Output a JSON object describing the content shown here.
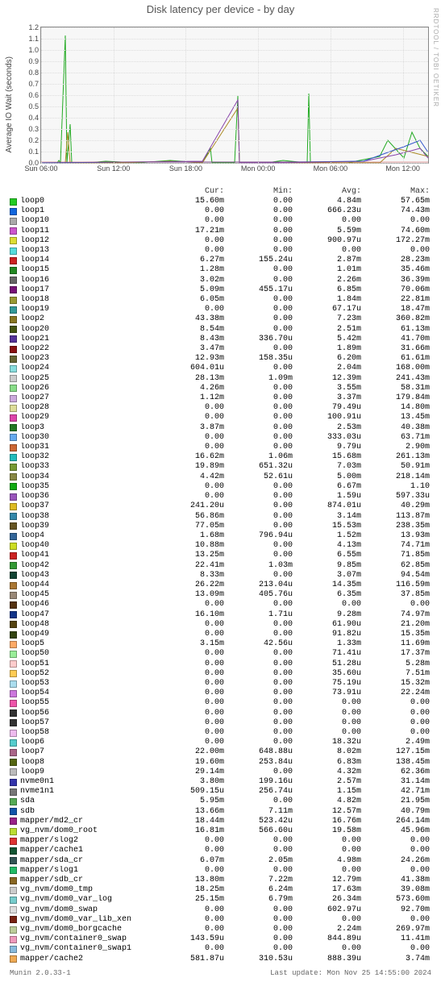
{
  "title": "Disk latency per device - by day",
  "ylabel": "Average IO Wait (seconds)",
  "side_credit": "RRDTOOL / TOBI OETIKER",
  "footer_left": "Munin 2.0.33-1",
  "footer_right": "Last update: Mon Nov 25 14:55:00 2024",
  "header": {
    "cur": "Cur:",
    "min": "Min:",
    "avg": "Avg:",
    "max": "Max:"
  },
  "chart_data": {
    "type": "line",
    "xlabel": "",
    "ylabel": "Average IO Wait (seconds)",
    "ylim": [
      0,
      1.2
    ],
    "yticks": [
      0.0,
      0.1,
      0.2,
      0.3,
      0.4,
      0.5,
      0.6,
      0.7,
      0.8,
      0.9,
      1.0,
      1.1,
      1.2
    ],
    "xticks": [
      "Sun 06:00",
      "Sun 12:00",
      "Sun 18:00",
      "Mon 00:00",
      "Mon 06:00",
      "Mon 12:00"
    ],
    "note": "Dense multi-series time-series; per-series summary stats given below (Cur/Min/Avg/Max). Values suffixed 'm' are milli (×1e-3), 'u' are micro (×1e-6).",
    "series": [
      {
        "name": "loop0",
        "color": "#22cc22",
        "cur": "15.60m",
        "min": "0.00",
        "avg": "4.84m",
        "max": "57.65m"
      },
      {
        "name": "loop1",
        "color": "#1166dd",
        "cur": "0.00",
        "min": "0.00",
        "avg": "666.23u",
        "max": "74.43m"
      },
      {
        "name": "loop10",
        "color": "#aaaaaa",
        "cur": "0.00",
        "min": "0.00",
        "avg": "0.00",
        "max": "0.00"
      },
      {
        "name": "loop11",
        "color": "#cc55cc",
        "cur": "17.21m",
        "min": "0.00",
        "avg": "5.59m",
        "max": "74.60m"
      },
      {
        "name": "loop12",
        "color": "#dddd33",
        "cur": "0.00",
        "min": "0.00",
        "avg": "900.97u",
        "max": "172.27m"
      },
      {
        "name": "loop13",
        "color": "#55dddd",
        "cur": "0.00",
        "min": "0.00",
        "avg": "0.00",
        "max": "0.00"
      },
      {
        "name": "loop14",
        "color": "#cc2222",
        "cur": "6.27m",
        "min": "155.24u",
        "avg": "2.87m",
        "max": "28.23m"
      },
      {
        "name": "loop15",
        "color": "#228822",
        "cur": "1.28m",
        "min": "0.00",
        "avg": "1.01m",
        "max": "35.46m"
      },
      {
        "name": "loop16",
        "color": "#666666",
        "cur": "3.02m",
        "min": "0.00",
        "avg": "2.26m",
        "max": "36.39m"
      },
      {
        "name": "loop17",
        "color": "#771177",
        "cur": "5.09m",
        "min": "455.17u",
        "avg": "6.85m",
        "max": "70.06m"
      },
      {
        "name": "loop18",
        "color": "#999933",
        "cur": "6.05m",
        "min": "0.00",
        "avg": "1.84m",
        "max": "22.81m"
      },
      {
        "name": "loop19",
        "color": "#339999",
        "cur": "0.00",
        "min": "0.00",
        "avg": "67.17u",
        "max": "18.47m"
      },
      {
        "name": "loop2",
        "color": "#887722",
        "cur": "43.38m",
        "min": "0.00",
        "avg": "7.23m",
        "max": "360.82m"
      },
      {
        "name": "loop20",
        "color": "#445511",
        "cur": "8.54m",
        "min": "0.00",
        "avg": "2.51m",
        "max": "61.13m"
      },
      {
        "name": "loop21",
        "color": "#553399",
        "cur": "8.43m",
        "min": "336.70u",
        "avg": "5.42m",
        "max": "41.70m"
      },
      {
        "name": "loop22",
        "color": "#881111",
        "cur": "3.47m",
        "min": "0.00",
        "avg": "1.89m",
        "max": "31.66m"
      },
      {
        "name": "loop23",
        "color": "#666633",
        "cur": "12.93m",
        "min": "158.35u",
        "avg": "6.20m",
        "max": "61.61m"
      },
      {
        "name": "loop24",
        "color": "#88dddd",
        "cur": "604.01u",
        "min": "0.00",
        "avg": "2.04m",
        "max": "168.00m"
      },
      {
        "name": "loop25",
        "color": "#cccccc",
        "cur": "28.13m",
        "min": "1.09m",
        "avg": "12.39m",
        "max": "241.43m"
      },
      {
        "name": "loop26",
        "color": "#88dd88",
        "cur": "4.26m",
        "min": "0.00",
        "avg": "3.55m",
        "max": "58.31m"
      },
      {
        "name": "loop27",
        "color": "#ccaadd",
        "cur": "1.12m",
        "min": "0.00",
        "avg": "3.37m",
        "max": "179.84m"
      },
      {
        "name": "loop28",
        "color": "#dddd99",
        "cur": "0.00",
        "min": "0.00",
        "avg": "79.49u",
        "max": "14.80m"
      },
      {
        "name": "loop29",
        "color": "#dd44aa",
        "cur": "0.00",
        "min": "0.00",
        "avg": "100.91u",
        "max": "13.45m"
      },
      {
        "name": "loop3",
        "color": "#227722",
        "cur": "3.87m",
        "min": "0.00",
        "avg": "2.53m",
        "max": "40.38m"
      },
      {
        "name": "loop30",
        "color": "#66aaee",
        "cur": "0.00",
        "min": "0.00",
        "avg": "333.03u",
        "max": "63.71m"
      },
      {
        "name": "loop31",
        "color": "#cc6633",
        "cur": "0.00",
        "min": "0.00",
        "avg": "9.79u",
        "max": "2.90m"
      },
      {
        "name": "loop32",
        "color": "#22bbbb",
        "cur": "16.62m",
        "min": "1.06m",
        "avg": "15.68m",
        "max": "261.13m"
      },
      {
        "name": "loop33",
        "color": "#779933",
        "cur": "19.89m",
        "min": "651.32u",
        "avg": "7.03m",
        "max": "50.91m"
      },
      {
        "name": "loop34",
        "color": "#888844",
        "cur": "4.42m",
        "min": "52.61u",
        "avg": "5.00m",
        "max": "218.14m"
      },
      {
        "name": "loop35",
        "color": "#11aa11",
        "cur": "0.00",
        "min": "0.00",
        "avg": "6.67m",
        "max": "1.10"
      },
      {
        "name": "loop36",
        "color": "#9955bb",
        "cur": "0.00",
        "min": "0.00",
        "avg": "1.59u",
        "max": "597.33u"
      },
      {
        "name": "loop37",
        "color": "#ddbb22",
        "cur": "241.20u",
        "min": "0.00",
        "avg": "874.01u",
        "max": "40.29m"
      },
      {
        "name": "loop38",
        "color": "#3388aa",
        "cur": "56.86m",
        "min": "0.00",
        "avg": "3.14m",
        "max": "113.87m"
      },
      {
        "name": "loop39",
        "color": "#665522",
        "cur": "77.05m",
        "min": "0.00",
        "avg": "15.53m",
        "max": "238.35m"
      },
      {
        "name": "loop4",
        "color": "#336699",
        "cur": "1.68m",
        "min": "796.94u",
        "avg": "1.52m",
        "max": "13.93m"
      },
      {
        "name": "loop40",
        "color": "#ccdd22",
        "cur": "10.88m",
        "min": "0.00",
        "avg": "4.13m",
        "max": "74.71m"
      },
      {
        "name": "loop41",
        "color": "#cc2222",
        "cur": "13.25m",
        "min": "0.00",
        "avg": "6.55m",
        "max": "71.85m"
      },
      {
        "name": "loop42",
        "color": "#339933",
        "cur": "22.41m",
        "min": "1.03m",
        "avg": "9.85m",
        "max": "62.85m"
      },
      {
        "name": "loop43",
        "color": "#114433",
        "cur": "8.33m",
        "min": "0.00",
        "avg": "3.07m",
        "max": "94.54m"
      },
      {
        "name": "loop44",
        "color": "#aa7733",
        "cur": "26.22m",
        "min": "213.04u",
        "avg": "14.35m",
        "max": "116.59m"
      },
      {
        "name": "loop45",
        "color": "#998877",
        "cur": "13.09m",
        "min": "405.76u",
        "avg": "6.35m",
        "max": "37.85m"
      },
      {
        "name": "loop46",
        "color": "#553311",
        "cur": "0.00",
        "min": "0.00",
        "avg": "0.00",
        "max": "0.00"
      },
      {
        "name": "loop47",
        "color": "#113388",
        "cur": "16.10m",
        "min": "1.71u",
        "avg": "9.28m",
        "max": "74.97m"
      },
      {
        "name": "loop48",
        "color": "#554411",
        "cur": "0.00",
        "min": "0.00",
        "avg": "61.90u",
        "max": "21.20m"
      },
      {
        "name": "loop49",
        "color": "#334411",
        "cur": "0.00",
        "min": "0.00",
        "avg": "91.82u",
        "max": "15.35m"
      },
      {
        "name": "loop5",
        "color": "#ffaa66",
        "cur": "3.15m",
        "min": "42.56u",
        "avg": "1.33m",
        "max": "11.69m"
      },
      {
        "name": "loop50",
        "color": "#99ee99",
        "cur": "0.00",
        "min": "0.00",
        "avg": "71.41u",
        "max": "17.37m"
      },
      {
        "name": "loop51",
        "color": "#ffcccc",
        "cur": "0.00",
        "min": "0.00",
        "avg": "51.28u",
        "max": "5.28m"
      },
      {
        "name": "loop52",
        "color": "#ffcc55",
        "cur": "0.00",
        "min": "0.00",
        "avg": "35.60u",
        "max": "7.51m"
      },
      {
        "name": "loop53",
        "color": "#aaddee",
        "cur": "0.00",
        "min": "0.00",
        "avg": "75.19u",
        "max": "15.32m"
      },
      {
        "name": "loop54",
        "color": "#cc77dd",
        "cur": "0.00",
        "min": "0.00",
        "avg": "73.91u",
        "max": "22.24m"
      },
      {
        "name": "loop55",
        "color": "#ee55aa",
        "cur": "0.00",
        "min": "0.00",
        "avg": "0.00",
        "max": "0.00"
      },
      {
        "name": "loop56",
        "color": "#333333",
        "cur": "0.00",
        "min": "0.00",
        "avg": "0.00",
        "max": "0.00"
      },
      {
        "name": "loop57",
        "color": "#333333",
        "cur": "0.00",
        "min": "0.00",
        "avg": "0.00",
        "max": "0.00"
      },
      {
        "name": "loop58",
        "color": "#eebbee",
        "cur": "0.00",
        "min": "0.00",
        "avg": "0.00",
        "max": "0.00"
      },
      {
        "name": "loop6",
        "color": "#55cccc",
        "cur": "0.00",
        "min": "0.00",
        "avg": "18.32u",
        "max": "2.49m"
      },
      {
        "name": "loop7",
        "color": "#aa6688",
        "cur": "22.00m",
        "min": "648.88u",
        "avg": "8.02m",
        "max": "127.15m"
      },
      {
        "name": "loop8",
        "color": "#556611",
        "cur": "19.60m",
        "min": "253.84u",
        "avg": "6.83m",
        "max": "138.45m"
      },
      {
        "name": "loop9",
        "color": "#bbbbbb",
        "cur": "29.14m",
        "min": "0.00",
        "avg": "4.32m",
        "max": "62.36m"
      },
      {
        "name": "nvme0n1",
        "color": "#3333aa",
        "cur": "3.80m",
        "min": "199.16u",
        "avg": "2.57m",
        "max": "31.14m"
      },
      {
        "name": "nvme1n1",
        "color": "#777777",
        "cur": "509.15u",
        "min": "256.74u",
        "avg": "1.15m",
        "max": "42.71m"
      },
      {
        "name": "sda",
        "color": "#55aa55",
        "cur": "5.95m",
        "min": "0.00",
        "avg": "4.82m",
        "max": "21.95m"
      },
      {
        "name": "sdb",
        "color": "#1155aa",
        "cur": "13.66m",
        "min": "7.11m",
        "avg": "12.57m",
        "max": "40.79m"
      },
      {
        "name": "mapper/md2_cr",
        "color": "#992288",
        "cur": "18.44m",
        "min": "523.42u",
        "avg": "16.76m",
        "max": "264.14m"
      },
      {
        "name": "vg_nvm/dom0_root",
        "color": "#bbdd33",
        "cur": "16.81m",
        "min": "566.60u",
        "avg": "19.58m",
        "max": "45.96m"
      },
      {
        "name": "mapper/slog2",
        "color": "#dd3333",
        "cur": "0.00",
        "min": "0.00",
        "avg": "0.00",
        "max": "0.00"
      },
      {
        "name": "mapper/cache1",
        "color": "#115533",
        "cur": "0.00",
        "min": "0.00",
        "avg": "0.00",
        "max": "0.00"
      },
      {
        "name": "mapper/sda_cr",
        "color": "#335555",
        "cur": "6.07m",
        "min": "2.05m",
        "avg": "4.98m",
        "max": "24.26m"
      },
      {
        "name": "mapper/slog1",
        "color": "#22bb66",
        "cur": "0.00",
        "min": "0.00",
        "avg": "0.00",
        "max": "0.00"
      },
      {
        "name": "mapper/sdb_cr",
        "color": "#886622",
        "cur": "13.80m",
        "min": "7.22m",
        "avg": "12.79m",
        "max": "41.38m"
      },
      {
        "name": "vg_nvm/dom0_tmp",
        "color": "#cccccc",
        "cur": "18.25m",
        "min": "6.24m",
        "avg": "17.63m",
        "max": "39.08m"
      },
      {
        "name": "vg_nvm/dom0_var_log",
        "color": "#77cccc",
        "cur": "25.15m",
        "min": "6.79m",
        "avg": "26.34m",
        "max": "573.60m"
      },
      {
        "name": "vg_nvm/dom0_swap",
        "color": "#dddddd",
        "cur": "0.00",
        "min": "0.00",
        "avg": "602.97u",
        "max": "92.70m"
      },
      {
        "name": "vg_nvm/dom0_var_lib_xen",
        "color": "#772211",
        "cur": "0.00",
        "min": "0.00",
        "avg": "0.00",
        "max": "0.00"
      },
      {
        "name": "vg_nvm/dom0_borgcache",
        "color": "#bbcc99",
        "cur": "0.00",
        "min": "0.00",
        "avg": "2.24m",
        "max": "269.97m"
      },
      {
        "name": "vg_nvm/container0_swap",
        "color": "#ee99bb",
        "cur": "143.59u",
        "min": "0.00",
        "avg": "844.89u",
        "max": "11.41m"
      },
      {
        "name": "vg_nvm/container0_swap1",
        "color": "#88bbdd",
        "cur": "0.00",
        "min": "0.00",
        "avg": "0.00",
        "max": "0.00"
      },
      {
        "name": "mapper/cache2",
        "color": "#eeaa55",
        "cur": "581.87u",
        "min": "310.53u",
        "avg": "888.39u",
        "max": "3.74m"
      }
    ]
  }
}
